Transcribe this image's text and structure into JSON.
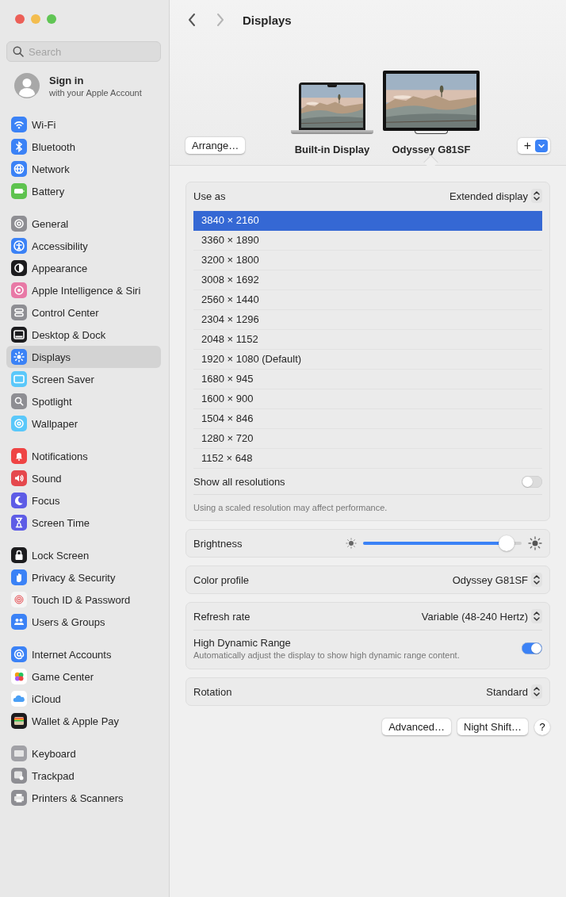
{
  "window": {
    "title": "Displays",
    "nav": [
      {
        "kind": "back",
        "disabled": false
      },
      {
        "kind": "forward",
        "disabled": true
      }
    ]
  },
  "sidebar": {
    "search": {
      "placeholder": "Search"
    },
    "account": {
      "title": "Sign in",
      "subtitle": "with your Apple Account"
    },
    "groups": [
      {
        "items": [
          {
            "label": "Wi-Fi",
            "selected": false
          },
          {
            "label": "Bluetooth",
            "selected": false
          },
          {
            "label": "Network",
            "selected": false
          },
          {
            "label": "Battery",
            "selected": false
          }
        ]
      },
      {
        "items": [
          {
            "label": "General",
            "selected": false
          },
          {
            "label": "Accessibility",
            "selected": false
          },
          {
            "label": "Appearance",
            "selected": false
          },
          {
            "label": "Apple Intelligence & Siri",
            "selected": false
          },
          {
            "label": "Control Center",
            "selected": false
          },
          {
            "label": "Desktop & Dock",
            "selected": false
          },
          {
            "label": "Displays",
            "selected": true
          },
          {
            "label": "Screen Saver",
            "selected": false
          },
          {
            "label": "Spotlight",
            "selected": false
          },
          {
            "label": "Wallpaper",
            "selected": false
          }
        ]
      },
      {
        "items": [
          {
            "label": "Notifications",
            "selected": false
          },
          {
            "label": "Sound",
            "selected": false
          },
          {
            "label": "Focus",
            "selected": false
          },
          {
            "label": "Screen Time",
            "selected": false
          }
        ]
      },
      {
        "items": [
          {
            "label": "Lock Screen",
            "selected": false
          },
          {
            "label": "Privacy & Security",
            "selected": false
          },
          {
            "label": "Touch ID & Password",
            "selected": false
          },
          {
            "label": "Users & Groups",
            "selected": false
          }
        ]
      },
      {
        "items": [
          {
            "label": "Internet Accounts",
            "selected": false
          },
          {
            "label": "Game Center",
            "selected": false
          },
          {
            "label": "iCloud",
            "selected": false
          },
          {
            "label": "Wallet & Apple Pay",
            "selected": false
          }
        ]
      },
      {
        "items": [
          {
            "label": "Keyboard",
            "selected": false
          },
          {
            "label": "Trackpad",
            "selected": false
          },
          {
            "label": "Printers & Scanners",
            "selected": false
          }
        ]
      }
    ]
  },
  "arrangement": {
    "arrange_button": "Arrange…",
    "add_button": "+",
    "displays": [
      {
        "label": "Built-in Display",
        "kind": "laptop",
        "selected": false
      },
      {
        "label": "Odyssey G81SF",
        "kind": "monitor",
        "selected": true
      }
    ]
  },
  "use_as": {
    "label": "Use as",
    "value": "Extended display"
  },
  "resolutions": [
    {
      "label": "3840 × 2160",
      "selected": true
    },
    {
      "label": "3360 × 1890",
      "selected": false
    },
    {
      "label": "3200 × 1800",
      "selected": false
    },
    {
      "label": "3008 × 1692",
      "selected": false
    },
    {
      "label": "2560 × 1440",
      "selected": false
    },
    {
      "label": "2304 × 1296",
      "selected": false
    },
    {
      "label": "2048 × 1152",
      "selected": false
    },
    {
      "label": "1920 × 1080 (Default)",
      "selected": false
    },
    {
      "label": "1680 × 945",
      "selected": false
    },
    {
      "label": "1600 × 900",
      "selected": false
    },
    {
      "label": "1504 × 846",
      "selected": false
    },
    {
      "label": "1280 × 720",
      "selected": false
    },
    {
      "label": "1152 × 648",
      "selected": false
    }
  ],
  "show_all": {
    "label": "Show all resolutions",
    "on": false
  },
  "note": "Using a scaled resolution may affect performance.",
  "brightness": {
    "label": "Brightness",
    "level": 0.95
  },
  "color_profile": {
    "label": "Color profile",
    "value": "Odyssey G81SF"
  },
  "refresh_rate": {
    "label": "Refresh rate",
    "value": "Variable (48-240 Hertz)"
  },
  "hdr": {
    "label": "High Dynamic Range",
    "description": "Automatically adjust the display to show high dynamic range content.",
    "on": true
  },
  "rotation": {
    "label": "Rotation",
    "value": "Standard"
  },
  "buttons": [
    {
      "label": "Advanced…",
      "kind": "text"
    },
    {
      "label": "Night Shift…",
      "kind": "text"
    },
    {
      "label": "?",
      "kind": "help"
    }
  ]
}
